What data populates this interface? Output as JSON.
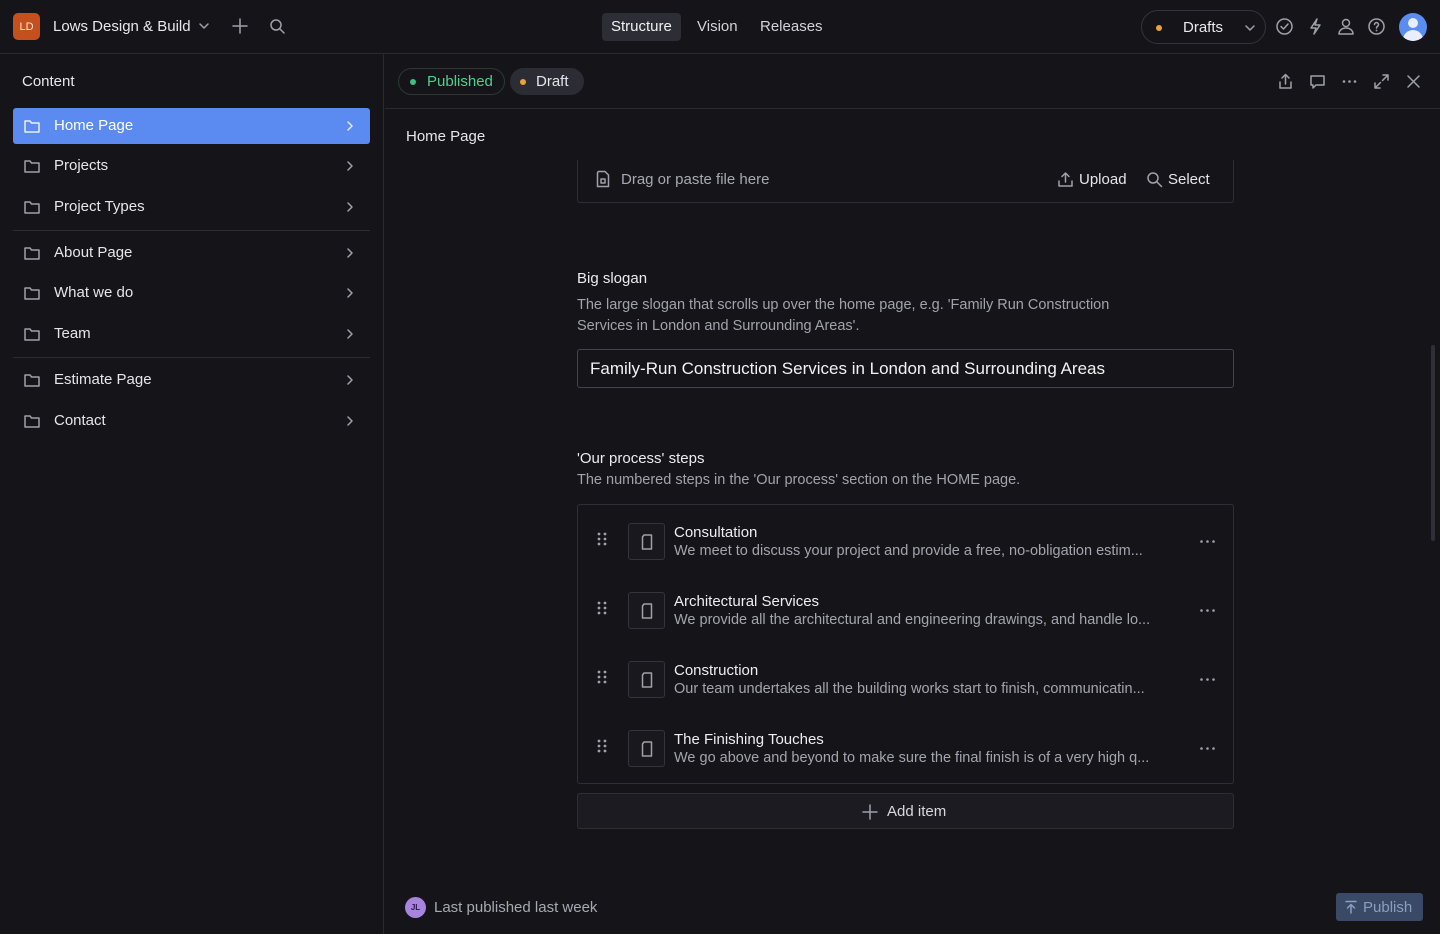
{
  "topbar": {
    "logo_initials": "LD",
    "project_name": "Lows Design & Build",
    "nav_tabs": [
      {
        "label": "Structure",
        "active": true
      },
      {
        "label": "Vision",
        "active": false
      },
      {
        "label": "Releases",
        "active": false
      }
    ],
    "perspective": {
      "label": "Drafts",
      "dot_color": "#e9a33b"
    },
    "icons": [
      "check-circle-icon",
      "bolt-icon",
      "users-icon",
      "help-icon"
    ]
  },
  "sidebar": {
    "title": "Content",
    "groups": [
      [
        {
          "label": "Home Page",
          "active": true
        },
        {
          "label": "Projects"
        },
        {
          "label": "Project Types"
        }
      ],
      [
        {
          "label": "About Page"
        },
        {
          "label": "What we do"
        },
        {
          "label": "Team"
        }
      ],
      [
        {
          "label": "Estimate Page"
        },
        {
          "label": "Contact"
        }
      ]
    ]
  },
  "document": {
    "status": {
      "published": "Published",
      "draft": "Draft"
    },
    "title": "Home Page",
    "upload": {
      "hint": "Drag or paste file here",
      "upload_label": "Upload",
      "select_label": "Select"
    },
    "big_slogan": {
      "label": "Big slogan",
      "description": "The large slogan that scrolls up over the home page, e.g. 'Family Run Construction Services in London and Surrounding Areas'.",
      "value": "Family-Run Construction Services in London and Surrounding Areas"
    },
    "process_steps": {
      "label": "'Our process' steps",
      "description": "The numbered steps in the 'Our process' section on the HOME page.",
      "items": [
        {
          "title": "Consultation",
          "subtitle": "We meet to discuss your project and provide a free, no-obligation estim..."
        },
        {
          "title": "Architectural Services",
          "subtitle": "We provide all the architectural and engineering drawings, and handle lo..."
        },
        {
          "title": "Construction",
          "subtitle": "Our team undertakes all the building works start to finish, communicatin..."
        },
        {
          "title": "The Finishing Touches",
          "subtitle": "We go above and beyond to make sure the final finish is of a very high q..."
        }
      ],
      "add_label": "Add item"
    }
  },
  "footer": {
    "avatar_initials": "JL",
    "status_text": "Last published last week",
    "publish_label": "Publish"
  },
  "colors": {
    "accent": "#5b8af0",
    "published_green": "#4fcf8f",
    "draft_orange": "#e9a33b",
    "background": "#151519"
  }
}
